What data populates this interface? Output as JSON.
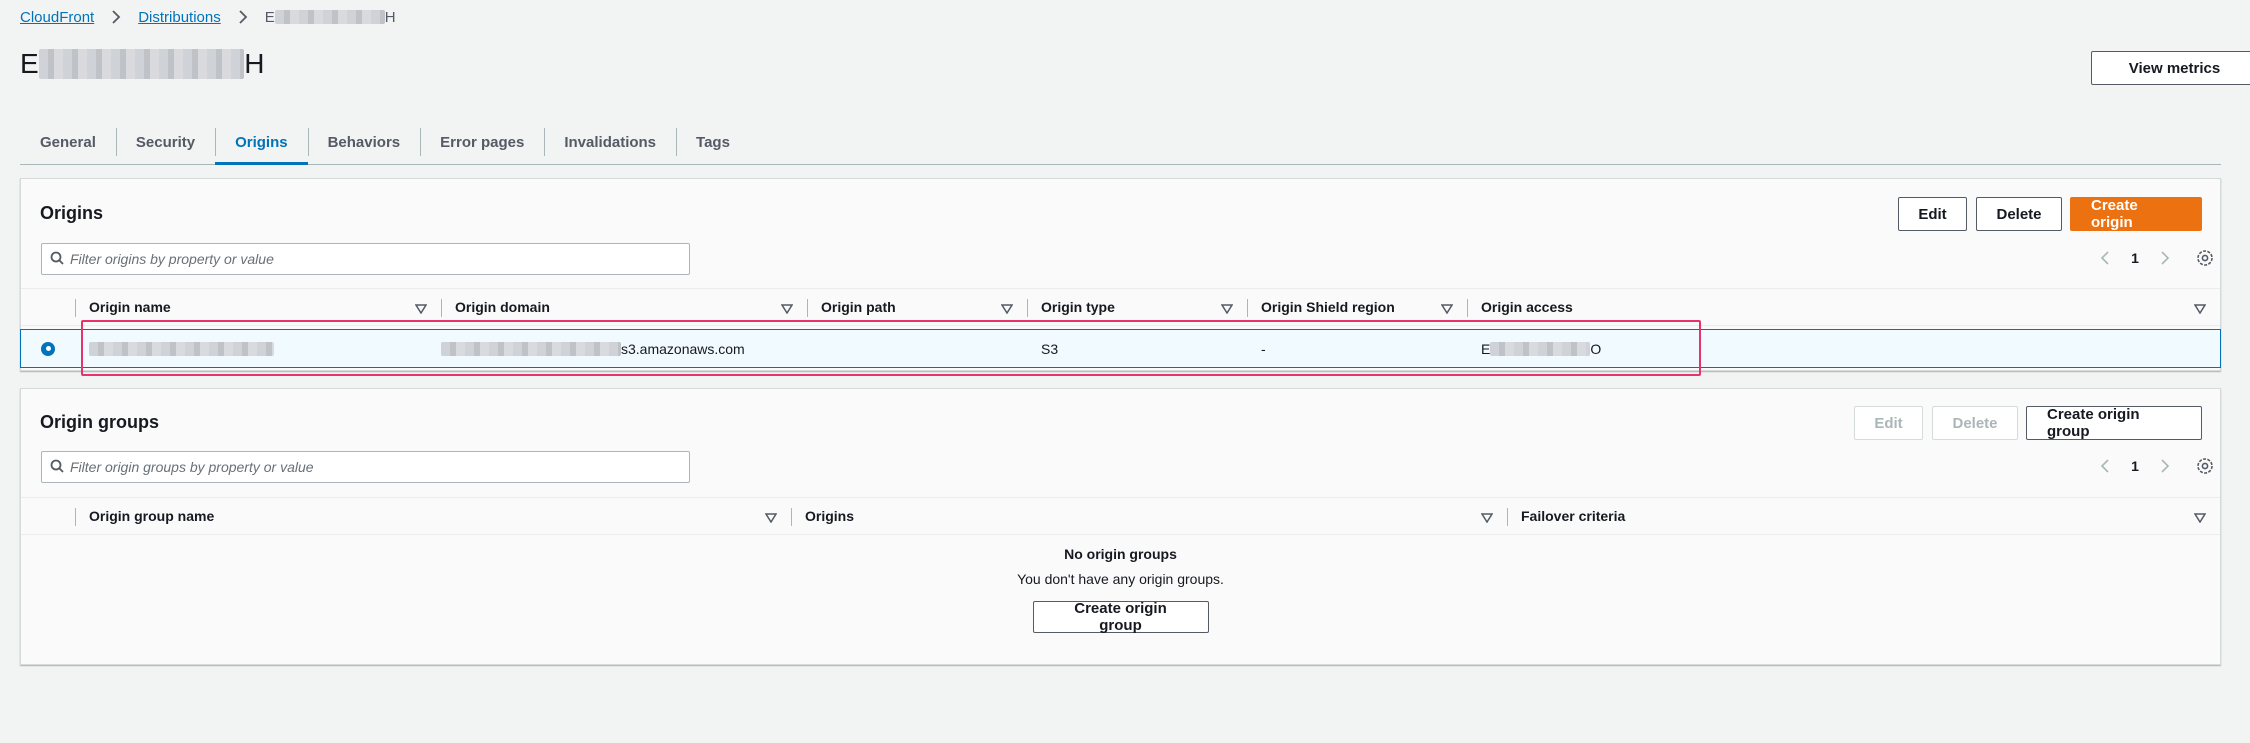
{
  "breadcrumb": {
    "root": "CloudFront",
    "parent": "Distributions",
    "current_prefix": "E",
    "current_suffix": "H"
  },
  "page": {
    "title_prefix": "E",
    "title_suffix": "H",
    "view_metrics": "View metrics"
  },
  "tabs": [
    {
      "label": "General"
    },
    {
      "label": "Security"
    },
    {
      "label": "Origins",
      "active": true
    },
    {
      "label": "Behaviors"
    },
    {
      "label": "Error pages"
    },
    {
      "label": "Invalidations"
    },
    {
      "label": "Tags"
    }
  ],
  "origins": {
    "title": "Origins",
    "edit": "Edit",
    "delete": "Delete",
    "create": "Create origin",
    "filter_placeholder": "Filter origins by property or value",
    "page": "1",
    "columns": [
      "Origin name",
      "Origin domain",
      "Origin path",
      "Origin type",
      "Origin Shield region",
      "Origin access"
    ],
    "row": {
      "origin_domain_suffix": "s3.amazonaws.com",
      "origin_path": "",
      "origin_type": "S3",
      "origin_shield_region": "-",
      "origin_access_prefix": "E",
      "origin_access_suffix": "O"
    }
  },
  "origin_groups": {
    "title": "Origin groups",
    "edit": "Edit",
    "delete": "Delete",
    "create": "Create origin group",
    "filter_placeholder": "Filter origin groups by property or value",
    "page": "1",
    "columns": [
      "Origin group name",
      "Origins",
      "Failover criteria"
    ],
    "empty_title": "No origin groups",
    "empty_text": "You don't have any origin groups.",
    "empty_button": "Create origin group"
  },
  "colors": {
    "accent": "#0073bb",
    "primary_button": "#ec7211",
    "highlight": "#e7336b"
  }
}
